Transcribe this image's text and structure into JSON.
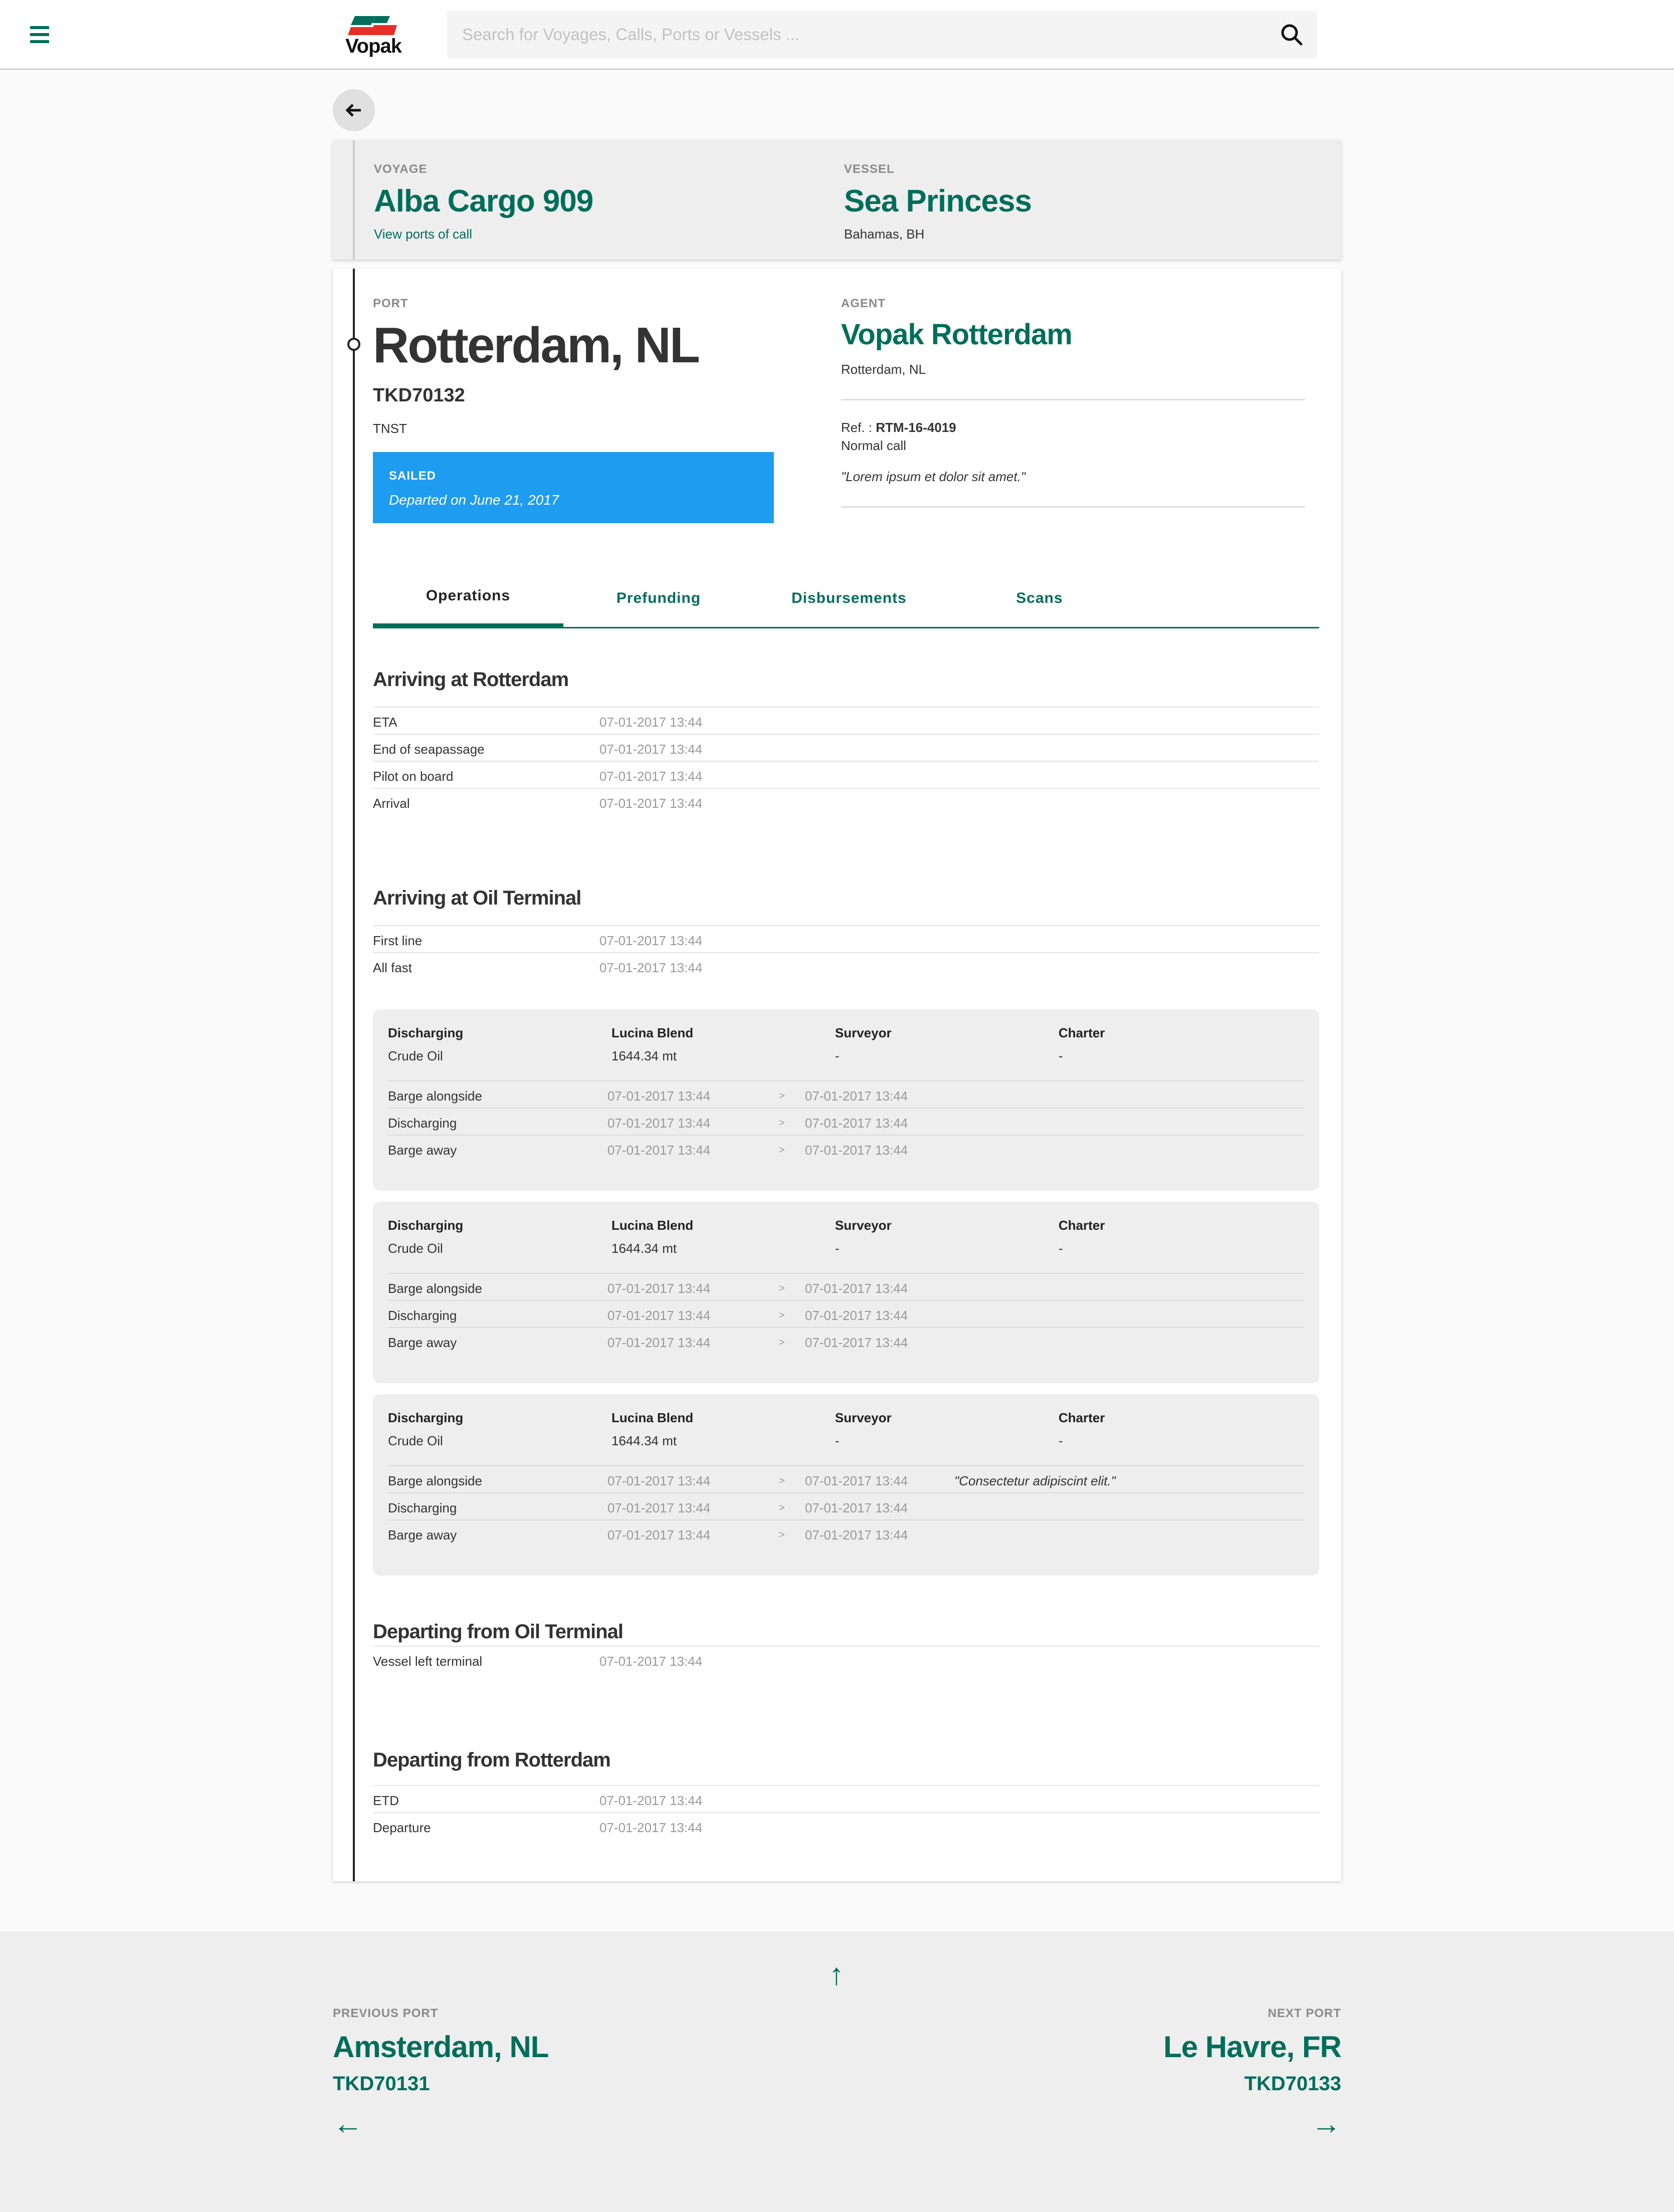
{
  "header": {
    "logo_text": "Vopak",
    "search_placeholder": "Search for Voyages, Calls, Ports or Vessels ..."
  },
  "voyage": {
    "voyage_label": "VOYAGE",
    "voyage_name": "Alba Cargo 909",
    "view_ports_link": "View ports of call",
    "vessel_label": "VESSEL",
    "vessel_name": "Sea Princess",
    "vessel_flag": "Bahamas, BH"
  },
  "port": {
    "label": "PORT",
    "name": "Rotterdam, NL",
    "code": "TKD70132",
    "type": "TNST",
    "status_title": "SAILED",
    "status_detail": "Departed on June 21, 2017"
  },
  "agent": {
    "label": "AGENT",
    "name": "Vopak Rotterdam",
    "location": "Rotterdam, NL",
    "ref_label": "Ref. : ",
    "ref_value": "RTM-16-4019",
    "call_type": "Normal call",
    "note": "\"Lorem ipsum et dolor sit amet.\""
  },
  "tabs": [
    "Operations",
    "Prefunding",
    "Disbursements",
    "Scans"
  ],
  "sections": {
    "arriving_rotterdam": {
      "title": "Arriving at Rotterdam",
      "rows": [
        {
          "k": "ETA",
          "v": "07-01-2017 13:44"
        },
        {
          "k": "End of seapassage",
          "v": "07-01-2017 13:44"
        },
        {
          "k": "Pilot on board",
          "v": "07-01-2017 13:44"
        },
        {
          "k": "Arrival",
          "v": "07-01-2017 13:44"
        }
      ]
    },
    "arriving_terminal": {
      "title": "Arriving at Oil Terminal",
      "rows": [
        {
          "k": "First line",
          "v": "07-01-2017 13:44"
        },
        {
          "k": "All fast",
          "v": "07-01-2017 13:44"
        }
      ]
    },
    "departing_terminal": {
      "title": "Departing from Oil Terminal",
      "rows": [
        {
          "k": "Vessel left terminal",
          "v": "07-01-2017 13:44"
        }
      ]
    },
    "departing_rotterdam": {
      "title": "Departing from Rotterdam",
      "rows": [
        {
          "k": "ETD",
          "v": "07-01-2017 13:44"
        },
        {
          "k": "Departure",
          "v": "07-01-2017 13:44"
        }
      ]
    }
  },
  "discharges": [
    {
      "h1": "Discharging",
      "s1": "Crude Oil",
      "h2": "Lucina Blend",
      "s2": "1644.34 mt",
      "h3": "Surveyor",
      "s3": "-",
      "h4": "Charter",
      "s4": "-",
      "rows": [
        {
          "k": "Barge alongside",
          "v1": "07-01-2017 13:44",
          "arr": ">",
          "v2": "07-01-2017 13:44",
          "note": ""
        },
        {
          "k": "Discharging",
          "v1": "07-01-2017 13:44",
          "arr": ">",
          "v2": "07-01-2017 13:44",
          "note": ""
        },
        {
          "k": "Barge away",
          "v1": "07-01-2017 13:44",
          "arr": ">",
          "v2": "07-01-2017 13:44",
          "note": ""
        }
      ]
    },
    {
      "h1": "Discharging",
      "s1": "Crude Oil",
      "h2": "Lucina Blend",
      "s2": "1644.34 mt",
      "h3": "Surveyor",
      "s3": "-",
      "h4": "Charter",
      "s4": "-",
      "rows": [
        {
          "k": "Barge alongside",
          "v1": "07-01-2017 13:44",
          "arr": ">",
          "v2": "07-01-2017 13:44",
          "note": ""
        },
        {
          "k": "Discharging",
          "v1": "07-01-2017 13:44",
          "arr": ">",
          "v2": "07-01-2017 13:44",
          "note": ""
        },
        {
          "k": "Barge away",
          "v1": "07-01-2017 13:44",
          "arr": ">",
          "v2": "07-01-2017 13:44",
          "note": ""
        }
      ]
    },
    {
      "h1": "Discharging",
      "s1": "Crude Oil",
      "h2": "Lucina Blend",
      "s2": "1644.34 mt",
      "h3": "Surveyor",
      "s3": "-",
      "h4": "Charter",
      "s4": "-",
      "rows": [
        {
          "k": "Barge alongside",
          "v1": "07-01-2017 13:44",
          "arr": ">",
          "v2": "07-01-2017 13:44",
          "note": "\"Consectetur adipiscint elit.\""
        },
        {
          "k": "Discharging",
          "v1": "07-01-2017 13:44",
          "arr": ">",
          "v2": "07-01-2017 13:44",
          "note": ""
        },
        {
          "k": "Barge away",
          "v1": "07-01-2017 13:44",
          "arr": ">",
          "v2": "07-01-2017 13:44",
          "note": ""
        }
      ]
    }
  ],
  "footer": {
    "up_arrow": "↑",
    "prev_label": "PREVIOUS PORT",
    "prev_name": "Amsterdam, NL",
    "prev_code": "TKD70131",
    "prev_arrow": "←",
    "next_label": "NEXT PORT",
    "next_name": "Le Havre, FR",
    "next_code": "TKD70133",
    "next_arrow": "→"
  }
}
